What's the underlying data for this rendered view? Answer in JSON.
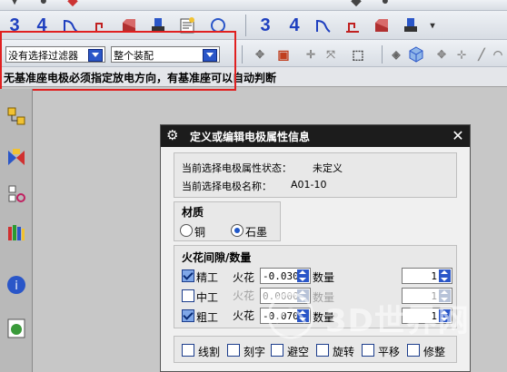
{
  "toolbar1": {
    "label_3": "3",
    "label_4": "4"
  },
  "toolbar2": {
    "label_3": "3",
    "label_4": "4"
  },
  "filter": {
    "selected": "没有选择过滤器"
  },
  "assembly": {
    "selected": "整个装配"
  },
  "status_message": "无基准座电极必须指定放电方向，有基准座可以自动判断",
  "dialog": {
    "title": "定义或编辑电极属性信息",
    "info": {
      "state_label": "当前选择电极属性状态：",
      "state_value": "未定义",
      "name_label": "当前选择电极名称：",
      "name_value": "A01-10"
    },
    "material": {
      "title": "材质",
      "options": [
        {
          "label": "铜",
          "selected": false
        },
        {
          "label": "石墨",
          "selected": true
        }
      ]
    },
    "spark": {
      "title": "火花间隙/数量",
      "rows": [
        {
          "checked": true,
          "name": "精工",
          "spark_label": "火花",
          "value": "-0.030",
          "qty_label": "数量",
          "qty": "1",
          "enabled": true
        },
        {
          "checked": false,
          "name": "中工",
          "spark_label": "火花",
          "value": "0.0000",
          "qty_label": "数量",
          "qty": "1",
          "enabled": false
        },
        {
          "checked": true,
          "name": "粗工",
          "spark_label": "火花",
          "value": "-0.070",
          "qty_label": "数量",
          "qty": "1",
          "enabled": true
        }
      ]
    },
    "options": [
      {
        "label": "线割",
        "checked": false
      },
      {
        "label": "刻字",
        "checked": false
      },
      {
        "label": "避空",
        "checked": false
      },
      {
        "label": "旋转",
        "checked": false
      },
      {
        "label": "平移",
        "checked": false
      },
      {
        "label": "修整",
        "checked": false
      }
    ]
  },
  "watermark": "3D世界网",
  "colors": {
    "highlight_box": "#e02020",
    "dialog_title_bg": "#1c1c1c",
    "accent": "#2a56c8"
  }
}
